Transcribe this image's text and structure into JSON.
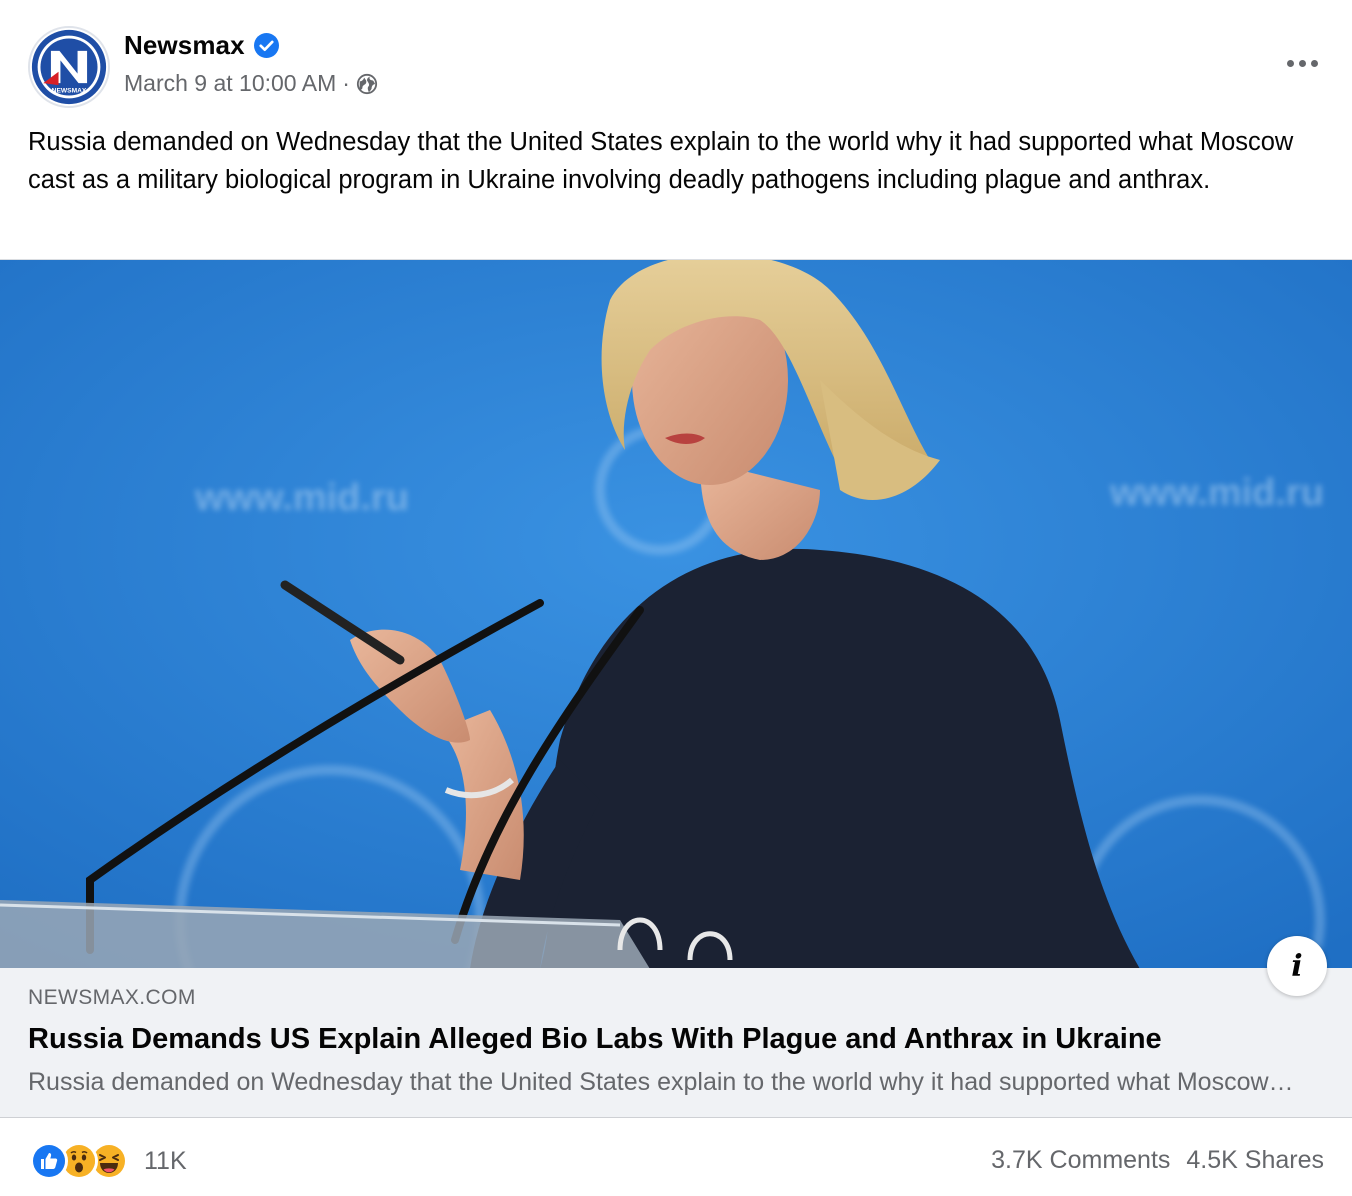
{
  "post": {
    "author": {
      "name": "Newsmax",
      "verified": true,
      "avatar_letter": "N",
      "avatar_caption": "NEWSMAX"
    },
    "timestamp": "March 9 at 10:00 AM",
    "separator": "·",
    "audience_icon": "globe-icon",
    "message": "Russia demanded on Wednesday that the United States explain to the world why it had supported what Moscow cast as a military biological program in Ukraine involving deadly pathogens including plague and anthrax.",
    "image": {
      "backdrop_text": "www.mid.ru",
      "info_label": "i"
    },
    "link": {
      "domain": "NEWSMAX.COM",
      "title": "Russia Demands US Explain Alleged Bio Labs With Plague and Anthrax in Ukraine",
      "description": "Russia demanded on Wednesday that the United States explain to the world why it had supported what Moscow cast as a military biological program in Ukraine involving deadly pathogens including plague and anthrax."
    },
    "reactions": {
      "types": [
        "like-icon",
        "wow-icon",
        "haha-icon"
      ],
      "count": "11K"
    },
    "comments": "3.7K Comments",
    "shares": "4.5K Shares"
  },
  "colors": {
    "secondary_text": "#65676b",
    "verified_blue": "#1877f2",
    "link_bg": "#f0f2f5",
    "backdrop_blue": "#2f86d8"
  }
}
